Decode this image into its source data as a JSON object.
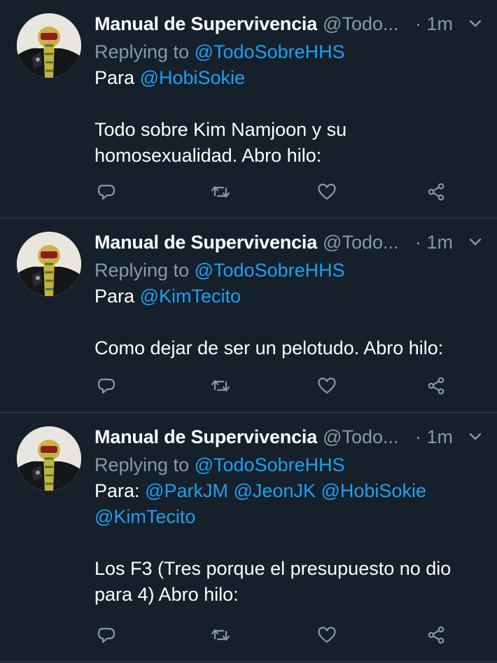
{
  "colors": {
    "background": "#15202b",
    "divider": "#38444d",
    "secondary_text": "#8899a6",
    "link": "#1da1f2",
    "primary_text": "#ffffff"
  },
  "tweets": [
    {
      "display_name": "Manual de Supervivencia",
      "handle": "@Todo...",
      "time": "· 1m",
      "replying_label": "Replying to",
      "replying_to": "@TodoSobreHHS",
      "para_prefix": "Para",
      "mentions_line1": [
        "@HobiSokie"
      ],
      "mentions_line2": [],
      "body_lines": [
        "Todo sobre Kim Namjoon y su",
        "homosexualidad. Abro hilo:"
      ],
      "icons": [
        "avatar",
        "chevron-down-icon",
        "reply-icon",
        "retweet-icon",
        "like-icon",
        "share-icon"
      ]
    },
    {
      "display_name": "Manual de Supervivencia",
      "handle": "@Todo...",
      "time": "· 1m",
      "replying_label": "Replying to",
      "replying_to": "@TodoSobreHHS",
      "para_prefix": "Para",
      "mentions_line1": [
        "@KimTecito"
      ],
      "mentions_line2": [],
      "body_lines": [
        "Como dejar de ser un pelotudo. Abro hilo:"
      ],
      "icons": [
        "avatar",
        "chevron-down-icon",
        "reply-icon",
        "retweet-icon",
        "like-icon",
        "share-icon"
      ]
    },
    {
      "display_name": "Manual de Supervivencia",
      "handle": "@Todo...",
      "time": "· 1m",
      "replying_label": "Replying to",
      "replying_to": "@TodoSobreHHS",
      "para_prefix": "Para:",
      "mentions_line1": [
        "@ParkJM",
        "@JeonJK",
        "@HobiSokie"
      ],
      "mentions_line2": [
        "@KimTecito"
      ],
      "body_lines": [
        "Los F3 (Tres porque el presupuesto no dio",
        "para 4) Abro hilo:"
      ],
      "icons": [
        "avatar",
        "chevron-down-icon",
        "reply-icon",
        "retweet-icon",
        "like-icon",
        "share-icon"
      ]
    }
  ]
}
